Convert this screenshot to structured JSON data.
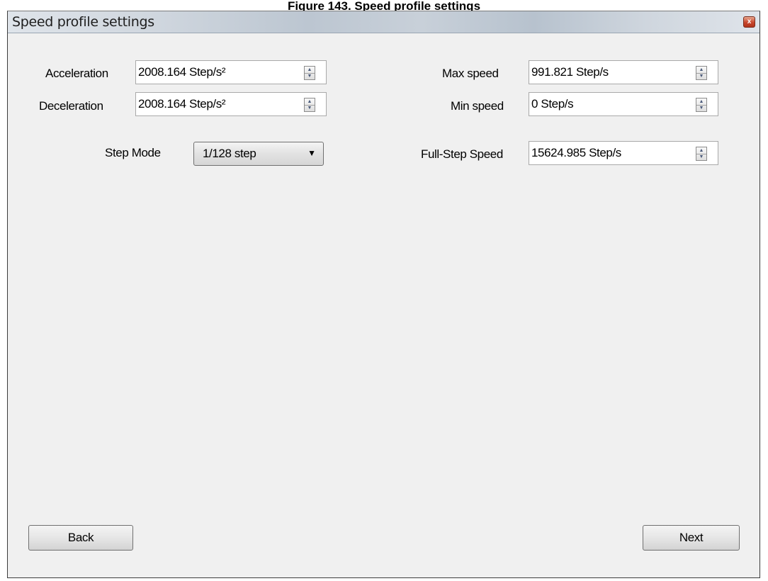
{
  "caption": "Figure 143. Speed profile settings",
  "window": {
    "title": "Speed profile settings",
    "close_label": "x"
  },
  "fields": {
    "acceleration": {
      "label": "Acceleration",
      "value": "2008.164 Step/s²"
    },
    "deceleration": {
      "label": "Deceleration",
      "value": "2008.164 Step/s²"
    },
    "max_speed": {
      "label": "Max speed",
      "value": "991.821 Step/s"
    },
    "min_speed": {
      "label": "Min speed",
      "value": "0 Step/s"
    },
    "full_step_speed": {
      "label": "Full-Step Speed",
      "value": "15624.985 Step/s"
    },
    "step_mode": {
      "label": "Step Mode",
      "value": "1/128 step"
    }
  },
  "buttons": {
    "back": "Back",
    "next": "Next"
  },
  "icons": {
    "spin_up": "▲",
    "spin_down": "▼",
    "dropdown": "▼"
  }
}
